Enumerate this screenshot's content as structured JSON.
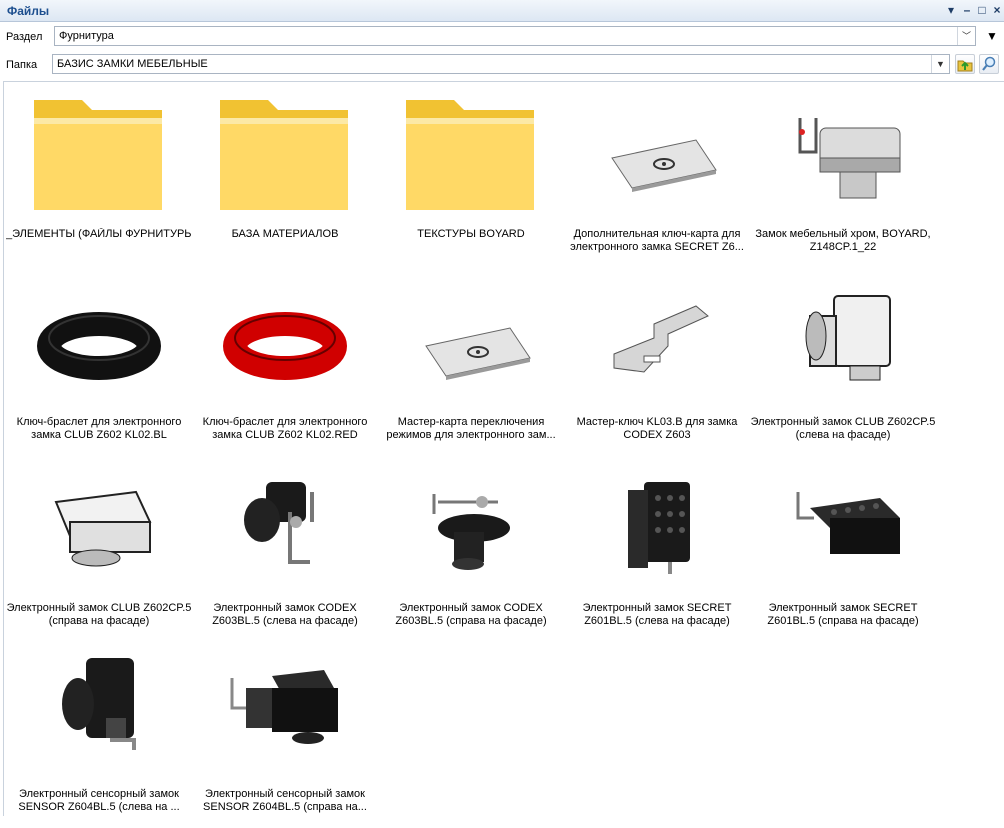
{
  "window": {
    "title": "Файлы"
  },
  "section": {
    "label": "Раздел",
    "value": "Фурнитура"
  },
  "folder": {
    "label": "Папка",
    "value": "БАЗИС ЗАМКИ МЕБЕЛЬНЫЕ"
  },
  "items": [
    {
      "type": "folder",
      "line1": "_ЭЛЕМЕНТЫ (ФАЙЛЫ ФУРНИТУРЫ)",
      "line2": ""
    },
    {
      "type": "folder",
      "line1": "БАЗА МАТЕРИАЛОВ",
      "line2": ""
    },
    {
      "type": "folder",
      "line1": "ТЕКСТУРЫ BOYARD",
      "line2": ""
    },
    {
      "type": "card",
      "line1": "Дополнительная ключ-карта для",
      "line2": "электронного замка SECRET Z6..."
    },
    {
      "type": "lock-chrome",
      "line1": "Замок мебельный хром, BOYARD,",
      "line2": "Z148CP.1_22"
    },
    {
      "type": "bracelet-black",
      "line1": "Ключ-браслет для электронного",
      "line2": "замка CLUB Z602 KL02.BL"
    },
    {
      "type": "bracelet-red",
      "line1": "Ключ-браслет для электронного",
      "line2": "замка CLUB Z602 KL02.RED"
    },
    {
      "type": "card",
      "line1": "Мастер-карта переключения",
      "line2": "режимов для электронного зам..."
    },
    {
      "type": "key",
      "line1": "Мастер-ключ KL03.B для замка",
      "line2": "CODEX Z603"
    },
    {
      "type": "lock-white-tall",
      "line1": "Электронный замок CLUB Z602CP.5",
      "line2": "(слева на фасаде)"
    },
    {
      "type": "lock-white",
      "line1": "Электронный замок CLUB Z602CP.5",
      "line2": "(справа на фасаде)"
    },
    {
      "type": "lock-codex-left",
      "line1": "Электронный замок CODEX",
      "line2": "Z603BL.5 (слева на фасаде)"
    },
    {
      "type": "lock-codex-right",
      "line1": "Электронный замок CODEX",
      "line2": "Z603BL.5 (справа на фасаде)"
    },
    {
      "type": "lock-secret-left",
      "line1": "Электронный замок SECRET",
      "line2": "Z601BL.5 (слева на фасаде)"
    },
    {
      "type": "lock-secret-right",
      "line1": "Электронный замок SECRET",
      "line2": "Z601BL.5 (справа на фасаде)"
    },
    {
      "type": "lock-sensor-left",
      "line1": "Электронный сенсорный замок",
      "line2": "SENSOR Z604BL.5 (слева на ..."
    },
    {
      "type": "lock-sensor-right",
      "line1": "Электронный сенсорный замок",
      "line2": "SENSOR Z604BL.5 (справа на..."
    }
  ]
}
